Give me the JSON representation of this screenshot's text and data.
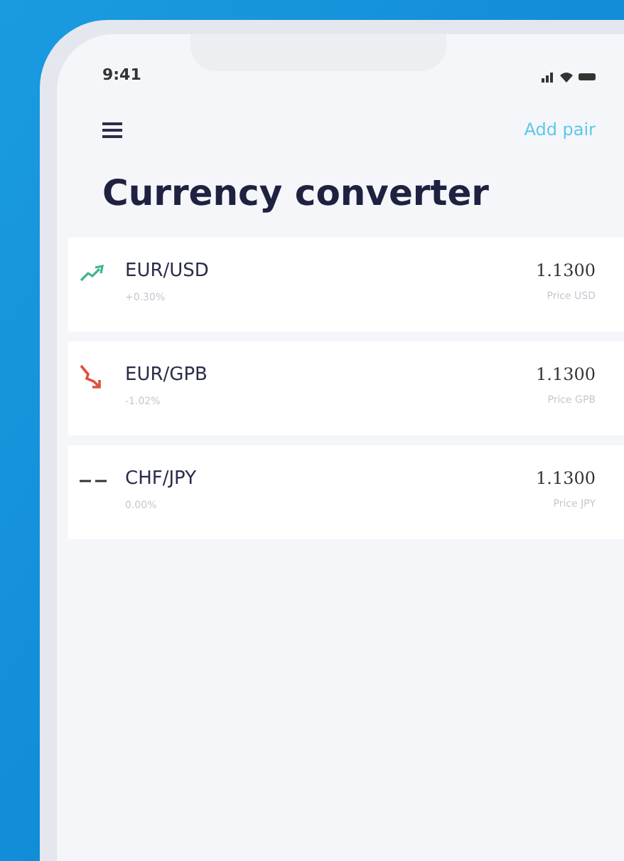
{
  "status_bar": {
    "time": "9:41"
  },
  "header": {
    "action": "Add pair"
  },
  "title": "Currency converter",
  "pairs": [
    {
      "name": "EUR/USD",
      "change": "+0.30%",
      "rate": "1.1300",
      "unit": "Price USD",
      "kind": "up"
    },
    {
      "name": "EUR/GPB",
      "change": "-1.02%",
      "rate": "1.1300",
      "unit": "Price GPB",
      "kind": "down"
    },
    {
      "name": "CHF/JPY",
      "change": "0.00%",
      "rate": "1.1300",
      "unit": "Price JPY",
      "kind": "flat"
    }
  ]
}
